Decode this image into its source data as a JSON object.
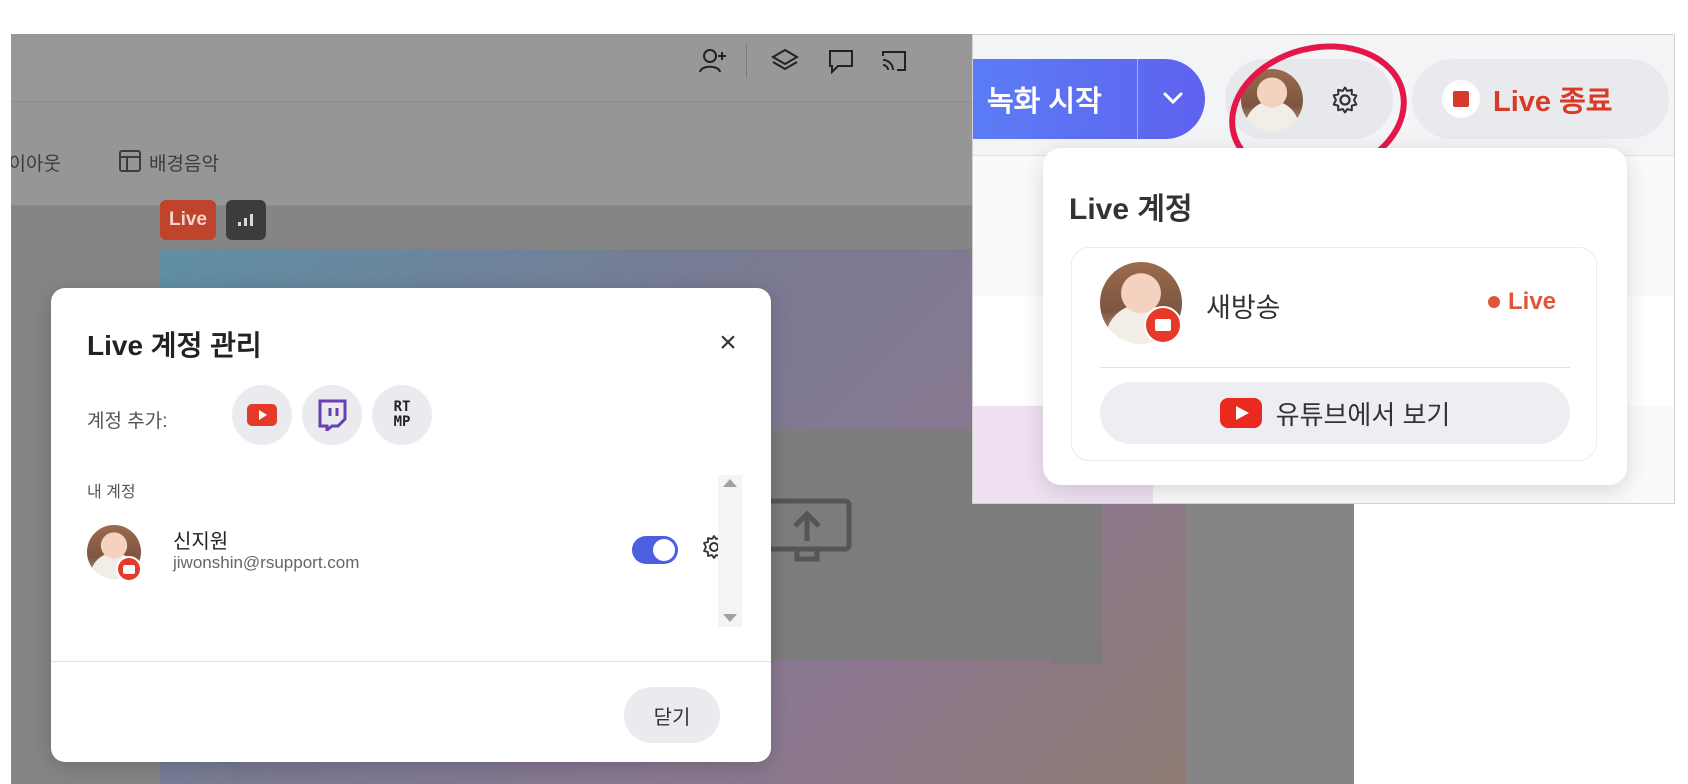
{
  "app": {
    "toolbar": {
      "layout_label": "레이아웃",
      "bgm_label": "배경음악"
    },
    "badges": {
      "live": "Live",
      "stats": "..ıl"
    }
  },
  "modal": {
    "title": "Live 계정 관리",
    "close_icon": "×",
    "add_label": "계정 추가:",
    "add_buttons": [
      {
        "name": "youtube",
        "icon": "youtube-icon"
      },
      {
        "name": "twitch",
        "icon": "twitch-icon"
      },
      {
        "name": "rtmp",
        "icon_text_1": "RT",
        "icon_text_2": "MP"
      }
    ],
    "my_accounts_label": "내 계정",
    "account": {
      "name": "신지원",
      "email": "jiwonshin@rsupport.com",
      "enabled": true
    },
    "close_button": "닫기"
  },
  "inset": {
    "record_button": "녹화 시작",
    "record_chevron": "⌄",
    "stop_button": "Live 종료",
    "dropdown": {
      "title": "Live 계정",
      "account_name": "새방송",
      "status": "Live",
      "youtube_button": "유튜브에서 보기"
    },
    "colors": {
      "accent": "#5e62ef",
      "live_red": "#d73a26",
      "highlight": "#e5174a"
    }
  }
}
